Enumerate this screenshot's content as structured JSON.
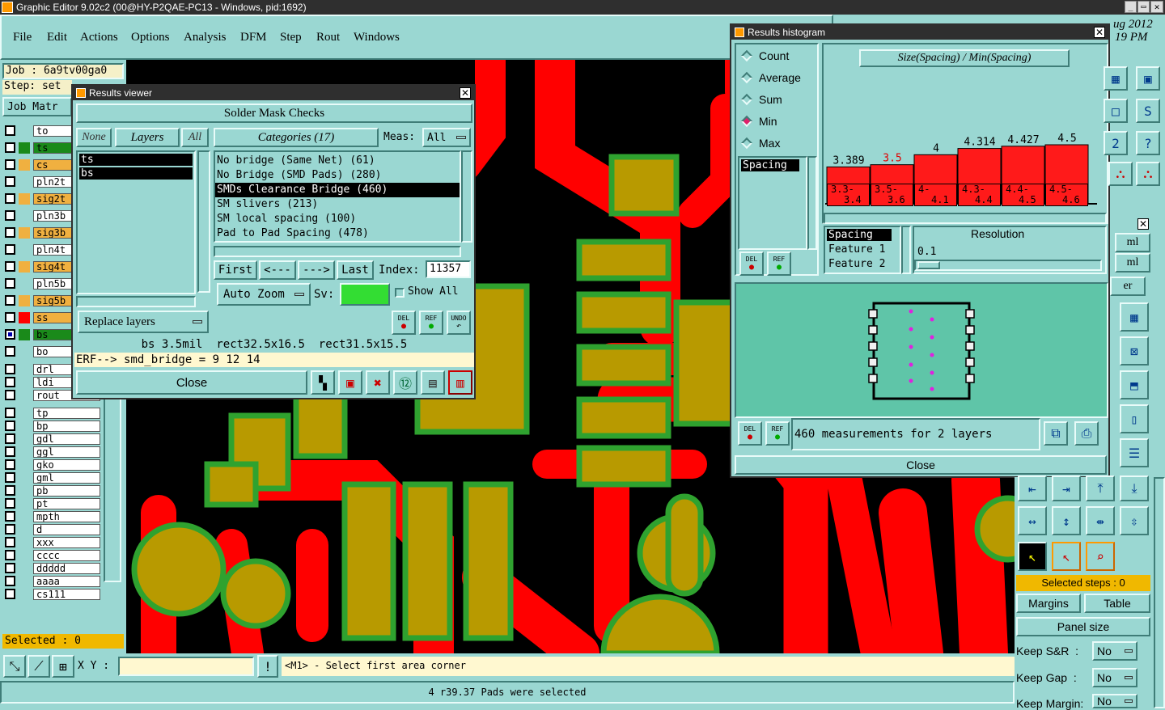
{
  "app": {
    "title": "Graphic Editor 9.02c2 (00@HY-P2QAE-PC13 - Windows, pid:1692)",
    "date_top": "ug 2012",
    "time_top": "19 PM"
  },
  "menu": [
    "File",
    "Edit",
    "Actions",
    "Options",
    "Analysis",
    "DFM",
    "Step",
    "Rout",
    "Windows"
  ],
  "left_panel": {
    "job": "Job : 6a9tv00ga0",
    "step": "Step: set",
    "job_matrix": "Job Matr",
    "layers": [
      {
        "name": "to",
        "color": ""
      },
      {
        "name": "ts",
        "color": "#1a8a1a"
      },
      {
        "name": "cs",
        "color": "#f0b040"
      },
      {
        "name": "pln2t",
        "color": ""
      },
      {
        "name": "sig2t",
        "color": "#f0b040"
      },
      {
        "name": "pln3b",
        "color": ""
      },
      {
        "name": "sig3b",
        "color": "#f0b040"
      },
      {
        "name": "pln4t",
        "color": ""
      },
      {
        "name": "sig4t",
        "color": "#f0b040"
      },
      {
        "name": "pln5b",
        "color": ""
      },
      {
        "name": "sig5b",
        "color": "#f0b040"
      },
      {
        "name": "ss",
        "color": "#ff0000"
      },
      {
        "name": "bs",
        "color": "#1a8a1a"
      },
      {
        "name": "bo",
        "color": ""
      },
      {
        "name": "drl",
        "color": ""
      },
      {
        "name": "ldi",
        "color": ""
      },
      {
        "name": "rout",
        "color": ""
      },
      {
        "name": "tp",
        "color": ""
      },
      {
        "name": "bp",
        "color": ""
      },
      {
        "name": "gdl",
        "color": ""
      },
      {
        "name": "ggl",
        "color": ""
      },
      {
        "name": "gko",
        "color": ""
      },
      {
        "name": "gml",
        "color": ""
      },
      {
        "name": "pb",
        "color": ""
      },
      {
        "name": "pt",
        "color": ""
      },
      {
        "name": "mpth",
        "color": ""
      },
      {
        "name": "d",
        "color": ""
      },
      {
        "name": "xxx",
        "color": ""
      },
      {
        "name": "cccc",
        "color": ""
      },
      {
        "name": "ddddd",
        "color": ""
      },
      {
        "name": "aaaa",
        "color": ""
      },
      {
        "name": "cs111",
        "color": ""
      }
    ],
    "selected": "Selected : 0"
  },
  "results_viewer": {
    "title": "Results viewer",
    "header": "Solder Mask Checks",
    "none_btn": "None",
    "layers_btn": "Layers",
    "all_btn": "All",
    "layer_list": [
      "ts",
      "bs"
    ],
    "categories_btn": "Categories (17)",
    "meas_label": "Meas:",
    "meas_value": "All",
    "categories": [
      "No bridge (Same Net) (61)",
      "No Bridge (SMD Pads) (280)",
      "SMDs Clearance Bridge (460)",
      "SM slivers (213)",
      "SM local spacing (100)",
      "Pad to Pad Spacing (478)"
    ],
    "selected_category_index": 2,
    "first_btn": "First",
    "prev_btn": "<---",
    "next_btn": "--->",
    "last_btn": "Last",
    "index_label": "Index:",
    "index_value": "11357",
    "auto_zoom": "Auto Zoom",
    "sv_label": "Sv:",
    "show_all": "Show All",
    "replace_layers": "Replace layers",
    "del": "DEL",
    "ref": "REF",
    "undo": "UNDO",
    "info": "bs 3.5mil  rect32.5x16.5  rect31.5x15.5",
    "erf": "ERF--> smd_bridge = 9 12 14",
    "close": "Close",
    "sv_color": "#33dd33"
  },
  "histogram": {
    "title": "Results histogram",
    "options": [
      "Count",
      "Average",
      "Sum",
      "Min",
      "Max"
    ],
    "selected_option_index": 3,
    "list_item": "Spacing",
    "heading": "Size(Spacing) / Min(Spacing)",
    "bars": [
      {
        "value": "3.389",
        "range": [
          "3.3-",
          "3.4"
        ],
        "highlight": false,
        "v": 3.389
      },
      {
        "value": "3.5",
        "range": [
          "3.5-",
          "3.6"
        ],
        "highlight": true,
        "v": 3.5
      },
      {
        "value": "4",
        "range": [
          "4-",
          "4.1"
        ],
        "highlight": false,
        "v": 4
      },
      {
        "value": "4.314",
        "range": [
          "4.3-",
          "4.4"
        ],
        "highlight": false,
        "v": 4.314
      },
      {
        "value": "4.427",
        "range": [
          "4.4-",
          "4.5"
        ],
        "highlight": false,
        "v": 4.427
      },
      {
        "value": "4.5",
        "range": [
          "4.5-",
          "4.6"
        ],
        "highlight": false,
        "v": 4.5
      }
    ],
    "feature_list": [
      "Spacing",
      "Feature 1",
      "Feature 2"
    ],
    "resolution_label": "Resolution",
    "resolution_value": "0.1",
    "measurements": "460 measurements for 2 layers",
    "close": "Close",
    "bar_color": "#ff1a1a"
  },
  "bottom": {
    "xy_label": "X Y :",
    "xy_value": "",
    "prompt": "<M1> - Select first area corner",
    "status": "4 r39.37 Pads were selected"
  },
  "right_panel": {
    "ml1": "ml",
    "ml2": "ml",
    "er": "er",
    "selected_steps": "Selected steps : 0",
    "margins": "Margins",
    "table": "Table",
    "panel_size": "Panel size",
    "keep_sr": "Keep S&R  :",
    "keep_sr_val": "No",
    "keep_gap": "Keep Gap  :",
    "keep_gap_val": "No",
    "keep_margin": "Keep Margin:",
    "keep_margin_val": "No"
  }
}
